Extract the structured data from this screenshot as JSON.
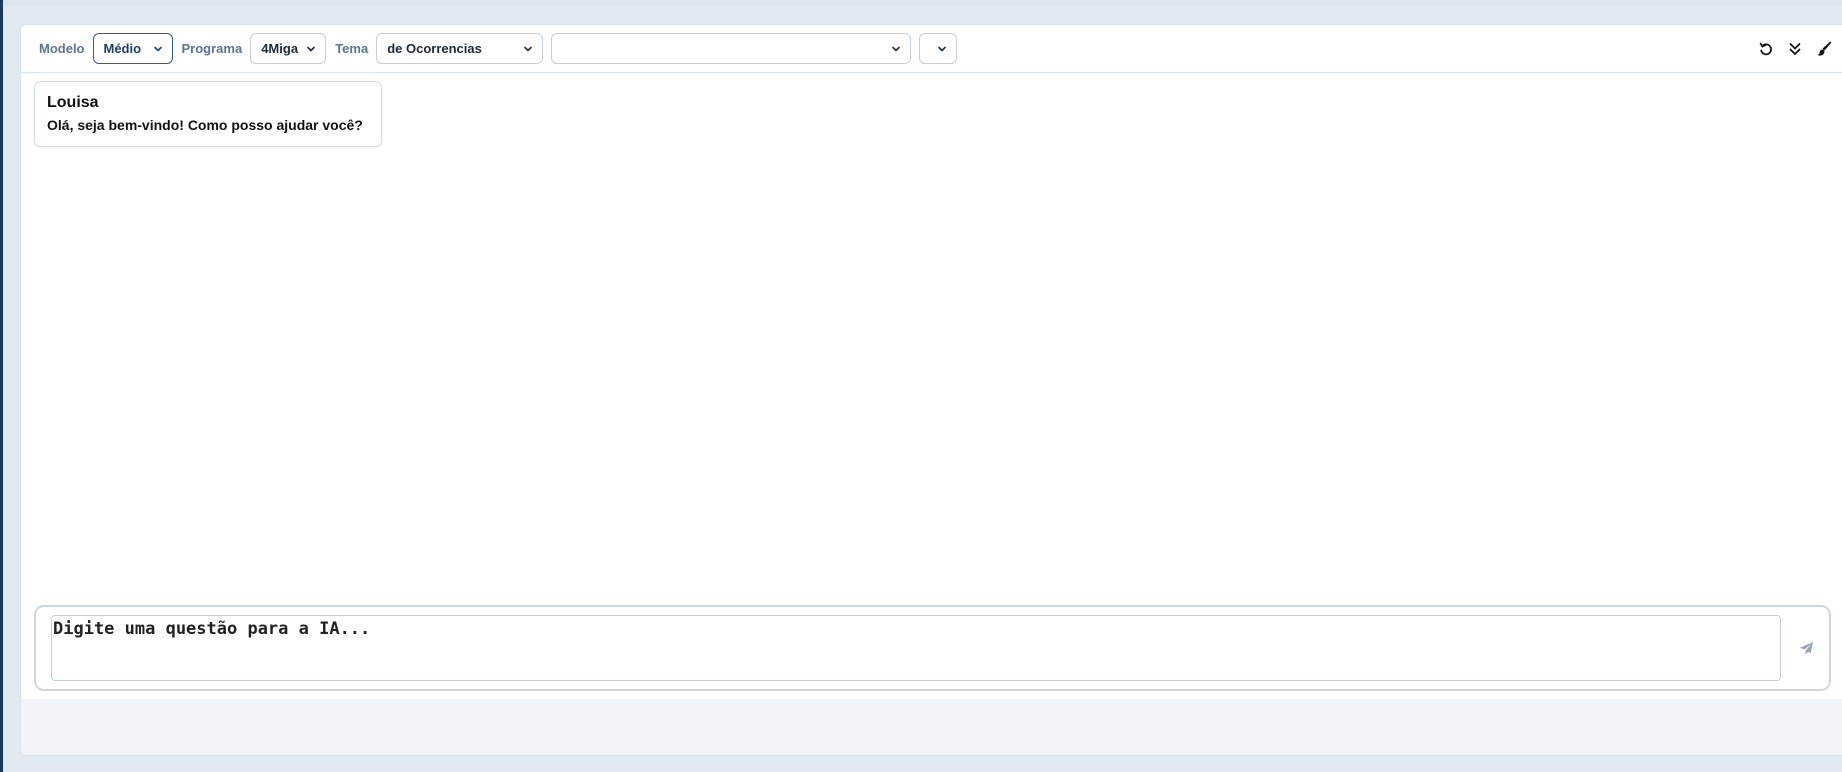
{
  "toolbar": {
    "modelo_label": "Modelo",
    "modelo_value": "Médio",
    "programa_label": "Programa",
    "programa_value": "4Miga",
    "tema_label": "Tema",
    "tema_value": "de Ocorrencias",
    "extra_select_1_value": "",
    "extra_select_2_value": "",
    "actions": [
      {
        "icon": "undo-icon"
      },
      {
        "icon": "chevrons-down-icon"
      },
      {
        "icon": "brush-icon"
      }
    ]
  },
  "messages": [
    {
      "author": "Louisa",
      "text": "Olá, seja bem-vindo! Como posso ajudar você?"
    }
  ],
  "composer": {
    "placeholder": "Digite uma questão para a IA...",
    "send_icon": "send-icon"
  },
  "colors": {
    "accent": "#2f5d8a",
    "label": "#5b7592",
    "background": "#f1f5f9"
  }
}
